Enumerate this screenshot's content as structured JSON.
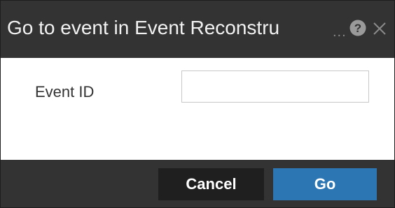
{
  "dialog": {
    "title": "Go to event in Event Reconstru",
    "title_overflow": "...",
    "help_icon": "help-circle-icon",
    "close_icon": "close-icon"
  },
  "form": {
    "event_id_label": "Event ID",
    "event_id_value": "",
    "event_id_placeholder": ""
  },
  "footer": {
    "cancel_label": "Cancel",
    "go_label": "Go"
  },
  "colors": {
    "titlebar_bg": "#333333",
    "body_bg": "#ffffff",
    "cancel_bg": "#1f1f1f",
    "go_bg": "#2c76b3"
  }
}
